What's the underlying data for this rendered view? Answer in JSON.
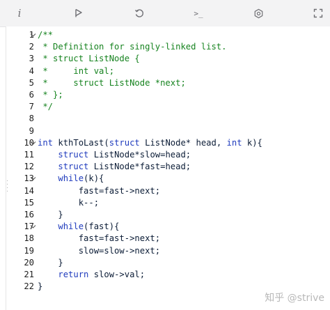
{
  "toolbar": {
    "buttons": [
      {
        "name": "info-icon",
        "label": "i"
      },
      {
        "name": "run-icon"
      },
      {
        "name": "reset-icon"
      },
      {
        "name": "terminal-icon",
        "label": ">_"
      },
      {
        "name": "settings-icon"
      },
      {
        "name": "fullscreen-icon"
      }
    ]
  },
  "editor": {
    "language": "c",
    "lines": [
      {
        "n": "1",
        "fold": true,
        "segs": [
          {
            "t": "/**",
            "c": "comment"
          }
        ]
      },
      {
        "n": "2",
        "fold": false,
        "segs": [
          {
            "t": " * Definition for singly-linked list.",
            "c": "comment"
          }
        ]
      },
      {
        "n": "3",
        "fold": false,
        "segs": [
          {
            "t": " * struct ListNode {",
            "c": "comment"
          }
        ]
      },
      {
        "n": "4",
        "fold": false,
        "segs": [
          {
            "t": " *     int val;",
            "c": "comment"
          }
        ]
      },
      {
        "n": "5",
        "fold": false,
        "segs": [
          {
            "t": " *     struct ListNode *next;",
            "c": "comment"
          }
        ]
      },
      {
        "n": "6",
        "fold": false,
        "segs": [
          {
            "t": " * };",
            "c": "comment"
          }
        ]
      },
      {
        "n": "7",
        "fold": false,
        "segs": [
          {
            "t": " */",
            "c": "comment"
          }
        ]
      },
      {
        "n": "8",
        "fold": false,
        "segs": []
      },
      {
        "n": "9",
        "fold": false,
        "segs": []
      },
      {
        "n": "10",
        "fold": true,
        "segs": [
          {
            "t": "int ",
            "c": "kw"
          },
          {
            "t": "kthToLast(",
            "c": "fn"
          },
          {
            "t": "struct ",
            "c": "kw"
          },
          {
            "t": "ListNode* head, ",
            "c": "plain"
          },
          {
            "t": "int ",
            "c": "kw"
          },
          {
            "t": "k){",
            "c": "plain"
          }
        ]
      },
      {
        "n": "11",
        "fold": false,
        "segs": [
          {
            "t": "    ",
            "c": "plain"
          },
          {
            "t": "struct ",
            "c": "kw"
          },
          {
            "t": "ListNode*slow=head;",
            "c": "plain"
          }
        ]
      },
      {
        "n": "12",
        "fold": false,
        "segs": [
          {
            "t": "    ",
            "c": "plain"
          },
          {
            "t": "struct ",
            "c": "kw"
          },
          {
            "t": "ListNode*fast=head;",
            "c": "plain"
          }
        ]
      },
      {
        "n": "13",
        "fold": true,
        "segs": [
          {
            "t": "    ",
            "c": "plain"
          },
          {
            "t": "while",
            "c": "kw"
          },
          {
            "t": "(k){",
            "c": "plain"
          }
        ]
      },
      {
        "n": "14",
        "fold": false,
        "segs": [
          {
            "t": "        fast=fast->next;",
            "c": "plain"
          }
        ]
      },
      {
        "n": "15",
        "fold": false,
        "segs": [
          {
            "t": "        k--;",
            "c": "plain"
          }
        ]
      },
      {
        "n": "16",
        "fold": false,
        "segs": [
          {
            "t": "    }",
            "c": "plain"
          }
        ]
      },
      {
        "n": "17",
        "fold": true,
        "segs": [
          {
            "t": "    ",
            "c": "plain"
          },
          {
            "t": "while",
            "c": "kw"
          },
          {
            "t": "(fast){",
            "c": "plain"
          }
        ]
      },
      {
        "n": "18",
        "fold": false,
        "segs": [
          {
            "t": "        fast=fast->next;",
            "c": "plain"
          }
        ]
      },
      {
        "n": "19",
        "fold": false,
        "segs": [
          {
            "t": "        slow=slow->next;",
            "c": "plain"
          }
        ]
      },
      {
        "n": "20",
        "fold": false,
        "segs": [
          {
            "t": "    }",
            "c": "plain"
          }
        ]
      },
      {
        "n": "21",
        "fold": false,
        "segs": [
          {
            "t": "    ",
            "c": "plain"
          },
          {
            "t": "return ",
            "c": "kw"
          },
          {
            "t": "slow->val;",
            "c": "plain"
          }
        ]
      },
      {
        "n": "22",
        "fold": false,
        "segs": [
          {
            "t": "}",
            "c": "plain"
          }
        ]
      }
    ]
  },
  "watermark": "知乎 @strive",
  "colors": {
    "comment": "#16831f",
    "keyword": "#1f3bbd",
    "text": "#0b1c36",
    "toolbar_bg": "#f3f3f4"
  }
}
